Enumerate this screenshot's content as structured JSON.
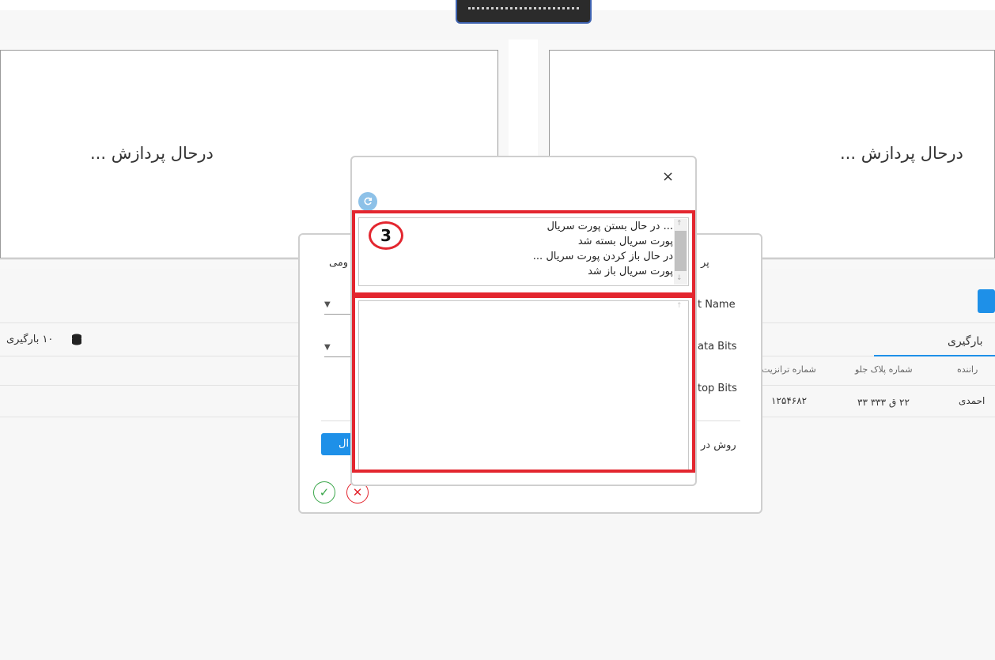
{
  "camera_panels": {
    "left_status": "درحال پردازش ...",
    "right_status": "درحال پردازش ..."
  },
  "list": {
    "loading_count_label": "۱۰ بارگیری",
    "tab_label": "بارگیری",
    "columns": [
      "شماره ترانزیت",
      "شماره پلاک جلو",
      "راننده"
    ],
    "rows": [
      [
        "۱۲۵۴۶۸۲",
        "۲۲ ق ۳۳۳ ۳۳",
        "احمدی"
      ]
    ]
  },
  "back_dialog": {
    "section_title_right": "پر",
    "section_title_left": "ومی",
    "fields": [
      "t Name",
      "ata Bits",
      "top Bits"
    ],
    "method_label": "روش در",
    "send_button_label": "ال"
  },
  "front_dialog": {
    "close_symbol": "×",
    "log_lines": [
      "... در حال بستن پورت سریال",
      "پورت سریال بسته شد",
      "در حال باز کردن پورت سریال ...",
      "پورت سریال باز شد"
    ],
    "output_text": ""
  },
  "annotation": {
    "badge_number": "3",
    "highlight_color": "#e3262f"
  },
  "colors": {
    "accent": "#1e90e8",
    "confirm": "#3aa64a",
    "cancel": "#e3262f"
  },
  "icons": {
    "refresh": "refresh-icon",
    "close": "close-icon",
    "database": "database-icon",
    "confirm": "check-icon",
    "cancel": "x-icon"
  }
}
